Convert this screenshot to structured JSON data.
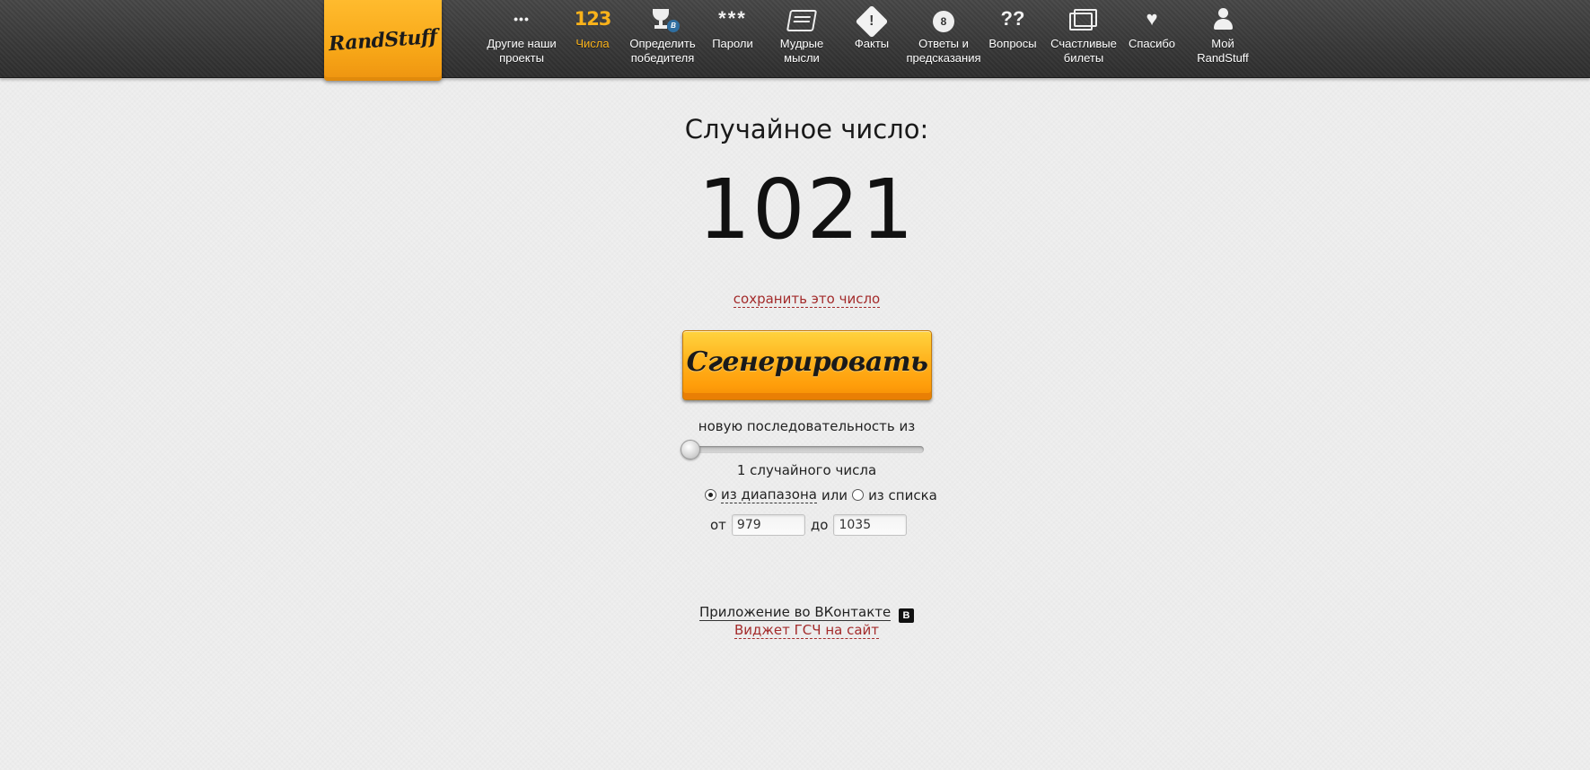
{
  "header": {
    "logo_text": "RandStuff",
    "nav": [
      {
        "id": "other-projects",
        "icon": "ellipsis-icon",
        "glyph": "•••",
        "line1": "Другие наши",
        "line2": "проекты"
      },
      {
        "id": "numbers",
        "icon": "numbers-icon",
        "glyph": "123",
        "line1": "Числа",
        "line2": "",
        "active": true
      },
      {
        "id": "winner",
        "icon": "trophy-icon",
        "glyph": "",
        "badge": "B",
        "line1": "Определить",
        "line2": "победителя"
      },
      {
        "id": "passwords",
        "icon": "asterisks-icon",
        "glyph": "***",
        "line1": "Пароли",
        "line2": ""
      },
      {
        "id": "wise-thoughts",
        "icon": "scroll-icon",
        "glyph": "",
        "line1": "Мудрые",
        "line2": "мысли"
      },
      {
        "id": "facts",
        "icon": "warning-icon",
        "glyph": "!",
        "line1": "Факты",
        "line2": ""
      },
      {
        "id": "answers",
        "icon": "magic-ball-icon",
        "glyph": "8",
        "line1": "Ответы и",
        "line2": "предсказания"
      },
      {
        "id": "questions",
        "icon": "question-marks-icon",
        "glyph": "??",
        "line1": "Вопросы",
        "line2": ""
      },
      {
        "id": "lucky-tickets",
        "icon": "tickets-icon",
        "glyph": "",
        "line1": "Счастливые",
        "line2": "билеты"
      },
      {
        "id": "thanks",
        "icon": "heart-icon",
        "glyph": "♥",
        "line1": "Спасибо",
        "line2": ""
      },
      {
        "id": "my-randstuff",
        "icon": "user-icon",
        "glyph": "",
        "line1": "Мой",
        "line2": "RandStuff"
      }
    ]
  },
  "main": {
    "heading": "Случайное число:",
    "number": "1021",
    "save_link": "сохранить это число",
    "generate_label": "Сгенерировать",
    "sequence_label": "новую последовательность из",
    "slider_value": 1,
    "count_label": "1 случайного числа",
    "mode": {
      "range_label": "из диапазона",
      "or_label": "или",
      "list_label": "из списка",
      "selected": "range"
    },
    "range": {
      "from_label": "от",
      "from_value": "979",
      "to_label": "до",
      "to_value": "1035"
    },
    "vk_app_link": "Приложение во ВКонтакте",
    "vk_icon_letter": "B",
    "widget_link": "Виджет ГСЧ на сайт"
  },
  "colors": {
    "accent": "#f9a61a",
    "link_red": "#a32b2b",
    "header_dark": "#333333"
  }
}
